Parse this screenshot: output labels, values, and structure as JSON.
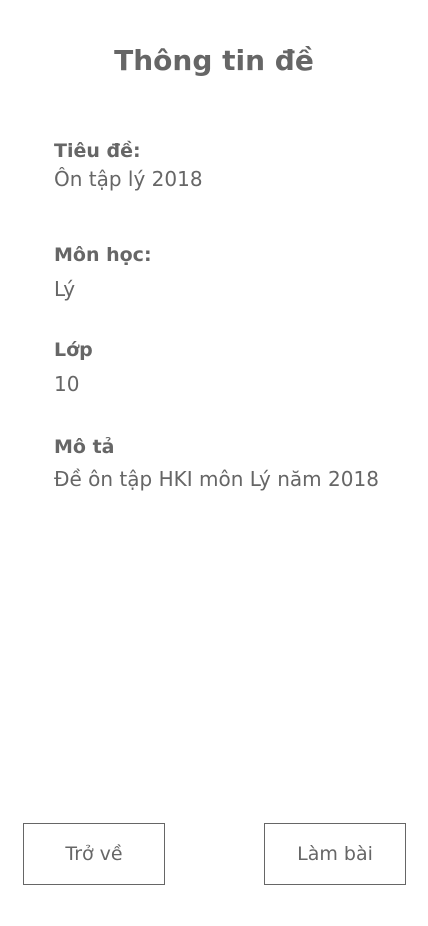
{
  "page": {
    "title": "Thông tin đề"
  },
  "fields": {
    "title": {
      "label": "Tiêu đề:",
      "value": "Ôn tập lý 2018"
    },
    "subject": {
      "label": "Môn học:",
      "value": "Lý"
    },
    "grade": {
      "label": "Lớp",
      "value": "10"
    },
    "description": {
      "label": "Mô tả",
      "value": "Đề ôn tập HKI môn Lý năm 2018"
    }
  },
  "actions": {
    "back_label": "Trở về",
    "start_label": "Làm bài"
  }
}
